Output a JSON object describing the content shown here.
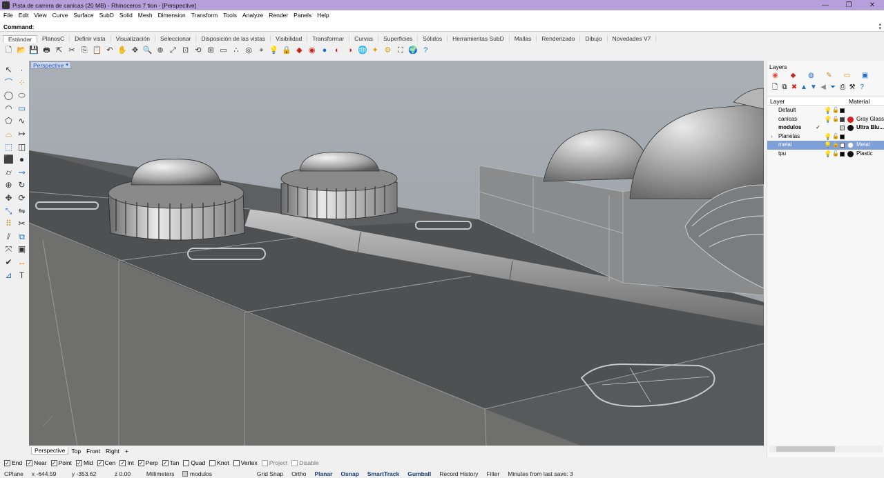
{
  "window": {
    "title": "Pista de carrera de canicas (20 MB) - Rhinoceros 7 tion - [Perspective]",
    "min": "—",
    "restore": "❐",
    "close": "✕"
  },
  "menu": [
    "File",
    "Edit",
    "View",
    "Curve",
    "Surface",
    "SubD",
    "Solid",
    "Mesh",
    "Dimension",
    "Transform",
    "Tools",
    "Analyze",
    "Render",
    "Panels",
    "Help"
  ],
  "command": {
    "label": "Command:",
    "value": ""
  },
  "toolbar_tabs": [
    "Estándar",
    "PlanosC",
    "Definir vista",
    "Visualización",
    "Seleccionar",
    "Disposición de las vistas",
    "Visibilidad",
    "Transformar",
    "Curvas",
    "Superficies",
    "Sólidos",
    "Herramientas SubD",
    "Mallas",
    "Renderizado",
    "Dibujo",
    "Novedades V7"
  ],
  "toolbar_icons": [
    {
      "name": "new-icon",
      "glyph": "🗋"
    },
    {
      "name": "open-icon",
      "glyph": "📂"
    },
    {
      "name": "save-icon",
      "glyph": "💾"
    },
    {
      "name": "print-icon",
      "glyph": "🖶"
    },
    {
      "name": "import-icon",
      "glyph": "⇱"
    },
    {
      "name": "cut-icon",
      "glyph": "✂"
    },
    {
      "name": "copy-icon",
      "glyph": "⎘"
    },
    {
      "name": "paste-icon",
      "glyph": "📋"
    },
    {
      "name": "undo-icon",
      "glyph": "↶"
    },
    {
      "name": "pan-icon",
      "glyph": "✋"
    },
    {
      "name": "rotate-view-icon",
      "glyph": "✥"
    },
    {
      "name": "zoom-icon",
      "glyph": "🔍"
    },
    {
      "name": "zoom-window-icon",
      "glyph": "⊕"
    },
    {
      "name": "zoom-extents-icon",
      "glyph": "⤢"
    },
    {
      "name": "zoom-selected-icon",
      "glyph": "⊡"
    },
    {
      "name": "undo-view-icon",
      "glyph": "⟲"
    },
    {
      "name": "four-viewports-icon",
      "glyph": "⊞"
    },
    {
      "name": "cplane-icon",
      "glyph": "▭"
    },
    {
      "name": "points-icon",
      "glyph": "∴"
    },
    {
      "name": "object-snap-icon",
      "glyph": "◎"
    },
    {
      "name": "select-icon",
      "glyph": "⌖"
    },
    {
      "name": "light-bulb-icon",
      "glyph": "💡"
    },
    {
      "name": "lock-icon",
      "glyph": "🔒"
    },
    {
      "name": "layer-icon",
      "glyph": "◆"
    },
    {
      "name": "color-wheel-icon",
      "glyph": "◉"
    },
    {
      "name": "shaded-sphere-icon",
      "glyph": "●"
    },
    {
      "name": "rendered-sphere-icon",
      "glyph": "◐"
    },
    {
      "name": "render-icon",
      "glyph": "◑"
    },
    {
      "name": "environment-icon",
      "glyph": "🌐"
    },
    {
      "name": "lamp-icon",
      "glyph": "✦"
    },
    {
      "name": "gear-icon",
      "glyph": "⚙"
    },
    {
      "name": "grasshopper-icon",
      "glyph": "⛶"
    },
    {
      "name": "globe-icon",
      "glyph": "🌍"
    },
    {
      "name": "help-icon",
      "glyph": "?"
    }
  ],
  "left_tools": [
    "select-arrow",
    "point",
    "polyline",
    "control-points",
    "circle",
    "ellipse",
    "arc",
    "rectangle",
    "polygon",
    "curve",
    "fillet",
    "extend",
    "extrude",
    "loft",
    "box",
    "sphere",
    "cylinder",
    "pipe",
    "boolean",
    "revolve",
    "move",
    "rotate",
    "scale",
    "mirror",
    "array",
    "trim",
    "split",
    "join",
    "explode",
    "group",
    "check",
    "dimension",
    "analyze",
    "text"
  ],
  "viewport": {
    "label": "Perspective",
    "caret": "▾"
  },
  "view_tabs": [
    "Perspective",
    "Top",
    "Front",
    "Right",
    "+"
  ],
  "snaps": [
    {
      "label": "End",
      "checked": true
    },
    {
      "label": "Near",
      "checked": true
    },
    {
      "label": "Point",
      "checked": true
    },
    {
      "label": "Mid",
      "checked": true
    },
    {
      "label": "Cen",
      "checked": true
    },
    {
      "label": "Int",
      "checked": true
    },
    {
      "label": "Perp",
      "checked": true
    },
    {
      "label": "Tan",
      "checked": true
    },
    {
      "label": "Quad",
      "checked": false
    },
    {
      "label": "Knot",
      "checked": false
    },
    {
      "label": "Vertex",
      "checked": false
    },
    {
      "label": "Project",
      "checked": false
    },
    {
      "label": "Disable",
      "checked": false
    }
  ],
  "status": {
    "cplane": "CPlane",
    "x": "x -644.59",
    "y": "y -353.62",
    "z": "z 0.00",
    "units": "Millimeters",
    "layer": "modulos",
    "grid_snap": "Grid Snap",
    "ortho": "Ortho",
    "planar": "Planar",
    "osnap": "Osnap",
    "smarttrack": "SmartTrack",
    "gumball": "Gumball",
    "record_history": "Record History",
    "filter": "Filter",
    "autosave": "Minutes from last save: 3"
  },
  "layers_panel": {
    "title": "Layers",
    "col_layer": "Layer",
    "col_material": "Material",
    "rows": [
      {
        "name": "Default",
        "color": "#000000",
        "material": "",
        "mat_color": "",
        "bold": false,
        "selected": false,
        "current": false,
        "expander": ""
      },
      {
        "name": "canicas",
        "color": "#3a3a3a",
        "material": "Gray Glass",
        "mat_color": "#d82020",
        "bold": false,
        "selected": false,
        "current": false,
        "expander": ""
      },
      {
        "name": "modulos",
        "color": "#d0d0d0",
        "material": "Ultra Blu...",
        "mat_color": "#111111",
        "bold": true,
        "selected": false,
        "current": true,
        "expander": ""
      },
      {
        "name": "Planetas",
        "color": "#000000",
        "material": "",
        "mat_color": "",
        "bold": false,
        "selected": false,
        "current": false,
        "expander": "›"
      },
      {
        "name": "metal",
        "color": "#ffffff",
        "material": "Metal",
        "mat_color": "#ffffff",
        "bold": false,
        "selected": true,
        "current": false,
        "expander": ""
      },
      {
        "name": "tpu",
        "color": "#000000",
        "material": "Plastic",
        "mat_color": "#111111",
        "bold": false,
        "selected": false,
        "current": false,
        "expander": ""
      }
    ]
  },
  "colors": {
    "titlebar": "#b79fdc",
    "selection": "#7ea0d7",
    "viewport_bg": "#9ea4a9"
  }
}
